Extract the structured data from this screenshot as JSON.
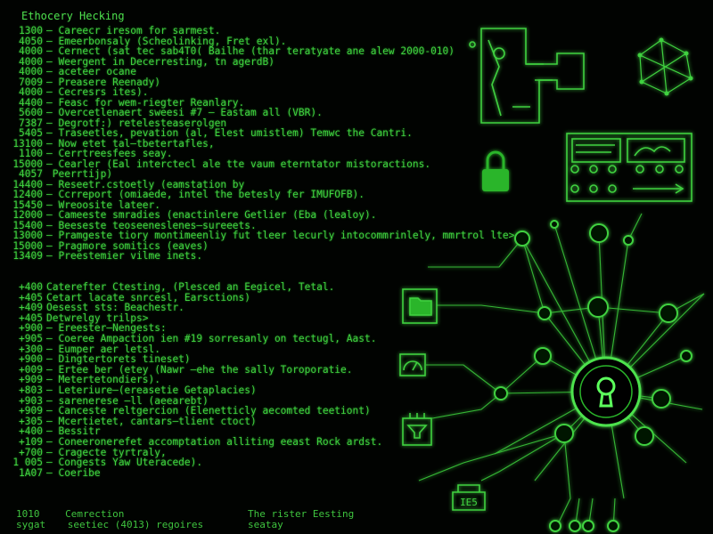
{
  "heading": "Ethocery Hecking",
  "block1": [
    {
      "num": "1300",
      "text": "– Careecr iresom for sarmest."
    },
    {
      "num": "4050",
      "text": "– Emeerbonsaly (Scheolinking, Fret exl)."
    },
    {
      "num": "4000",
      "text": "– Cernect (sat tec sab4T0(  Bailhe (thar teratyate ane alew 2000-010)"
    },
    {
      "num": "4000",
      "text": "– Weergent in Decerresting, tn agerdB)"
    },
    {
      "num": "4000",
      "text": "– aceteer ocane"
    },
    {
      "num": "7009",
      "text": "– Preasere Reenady)"
    },
    {
      "num": "4000",
      "text": "– Cecresrs ites)."
    },
    {
      "num": "4400",
      "text": "– Feasc for wem-riegter Reanlary."
    },
    {
      "num": "5600",
      "text": "– Overcetlenaert sweesi  #7 – Eastam all (VBR)."
    },
    {
      "num": "7387",
      "text": "– Degrotf:) retelesteaserolgen"
    },
    {
      "num": "5405",
      "text": "– Traseetles, pevation (al, Elest umistlem)  Temwc the Cantri."
    },
    {
      "num": "13100",
      "text": "– Now etet tal–tbetertafles,"
    },
    {
      "num": "1100",
      "text": "– Cerrtreesfees seay."
    },
    {
      "num": "15000",
      "text": "– Cearler (Eal interctecl ale tte vaum eterntator mistoractions."
    },
    {
      "num": "4057",
      "text": "  Peerrtijp)"
    },
    {
      "num": "14400",
      "text": "– Reseetr.cstoetly (eamstation by"
    },
    {
      "num": "12400",
      "text": "– Ccrreport (omiaede, intel the betesly fer IMUFOFB)."
    },
    {
      "num": "15450",
      "text": "– Wreoosite lateer."
    },
    {
      "num": "12000",
      "text": "– Cameeste smradies (enactinlere Getlier (Eba (lealoy)."
    },
    {
      "num": "15400",
      "text": "– Beeseste teoseeneslenes–sureeets."
    },
    {
      "num": "13000",
      "text": "– Pramgeste tiory montimeenliy fut tleer lecurly intocommrinlely, mmrtrol lte>"
    },
    {
      "num": "15000",
      "text": "– Pragmore somitics (eaves)"
    },
    {
      "num": "13409",
      "text": "– Preestemier vilme inets."
    }
  ],
  "block2": [
    {
      "num": "+400",
      "text": "Caterefter Ctesting, (Plesced an Eegicel, Tetal."
    },
    {
      "num": "+405",
      "text": "Cetart lacate snrcesl, Earsctions)"
    },
    {
      "num": "+409",
      "text": "Oesesst sts: Beachestr."
    },
    {
      "num": "+405",
      "text": "Detwrelgy trilps>"
    },
    {
      "num": "+900",
      "text": "– Ereester–Nengests:"
    },
    {
      "num": "+905",
      "text": "– Coeree Ampaction ien #19 sorresanly on tectugl, Aast."
    },
    {
      "num": "+300",
      "text": "– Eumper aer letsl."
    },
    {
      "num": "+900",
      "text": "– Dingtertorets tineset)"
    },
    {
      "num": "+009",
      "text": "– Ertee ber (etey (Nawr –ehe the sally Toroporatie."
    },
    {
      "num": "+909",
      "text": "– Metertetondiers)."
    },
    {
      "num": "+803",
      "text": "– Leteriure–(ereasetie Getaplacies)"
    },
    {
      "num": "+903",
      "text": "– sarenerese –ll (aeearebt)"
    },
    {
      "num": "+909",
      "text": "– Canceste reltgercion (Elenetticly aecomted teetiont)"
    },
    {
      "num": "+305",
      "text": "– Mcertietet, cantars–tlient ctoct)"
    },
    {
      "num": "+400",
      "text": "– Bessitr"
    },
    {
      "num": "+109",
      "text": "– Coneeronerefet accomptation alliting eeast Rock ardst."
    },
    {
      "num": "+700",
      "text": "– Cragecte tyrtraly,"
    },
    {
      "num": "1 005",
      "text": "– Congests Yaw Uteracede)."
    },
    {
      "num": "1A07",
      "text": "– Coeribe"
    }
  ],
  "footer": {
    "left_num1": "1010",
    "left_text1": "Cemrection",
    "left_num2": "sygat",
    "left_text2": "seetiec (4013) regoires",
    "right_line1": "The rister Eesting",
    "right_line2": "seatay"
  },
  "badge_text": "IE5",
  "colors": {
    "accent": "#3fd13f",
    "bright": "#5cff5c",
    "background": "#010301",
    "lock": "#2bb52b"
  }
}
